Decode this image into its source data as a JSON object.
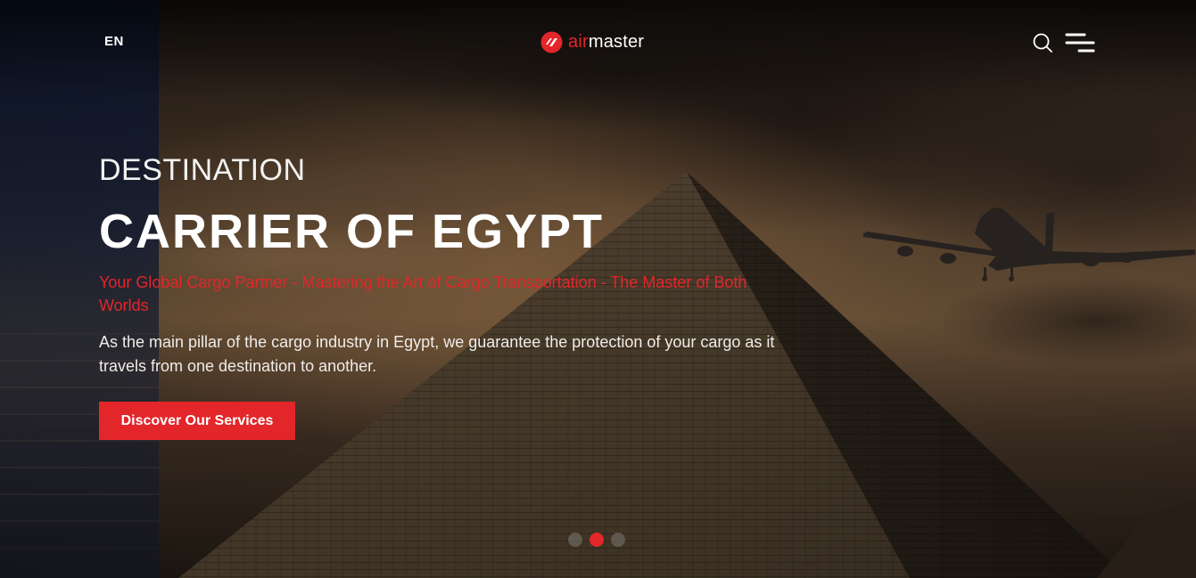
{
  "header": {
    "language": "EN",
    "logo": {
      "air": "air",
      "master": "master"
    },
    "icons": [
      "search-icon",
      "menu-icon"
    ]
  },
  "hero": {
    "eyebrow": "DESTINATION",
    "headline": "CARRIER OF EGYPT",
    "tagline": "Your Global Cargo Partner - Mastering the Art of Cargo Transportation - The Master of Both Worlds",
    "description": "As the main pillar of the cargo industry in Egypt, we guarantee the protection of your cargo as it travels from one destination to another.",
    "cta_label": "Discover Our Services"
  },
  "carousel": {
    "slide_count": 3,
    "active_index": 1
  },
  "colors": {
    "accent": "#e3262a",
    "text": "#ffffff"
  }
}
